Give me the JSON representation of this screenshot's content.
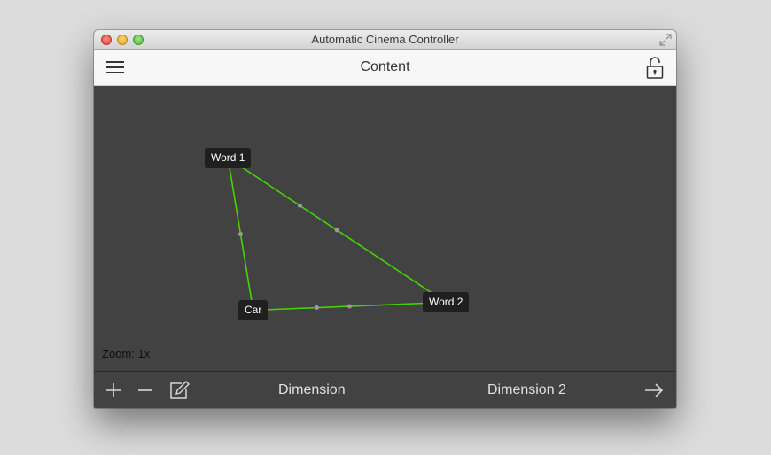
{
  "window": {
    "title": "Automatic Cinema Controller"
  },
  "toolbar": {
    "title": "Content",
    "menu_icon": "hamburger-menu-icon",
    "lock_icon": "unlocked-padlock-icon"
  },
  "graph": {
    "nodes": [
      {
        "id": "word1",
        "label": "Word 1"
      },
      {
        "id": "car",
        "label": "Car"
      },
      {
        "id": "word2",
        "label": "Word 2"
      }
    ],
    "edges": [
      {
        "from": "word1",
        "to": "word2"
      },
      {
        "from": "word1",
        "to": "car"
      },
      {
        "from": "car",
        "to": "word2"
      }
    ],
    "edge_color": "#46d400",
    "handle_color": "#9a9a9a"
  },
  "zoom": {
    "label": "Zoom: 1x"
  },
  "bottombar": {
    "add_icon": "plus-icon",
    "remove_icon": "minus-icon",
    "edit_icon": "edit-icon",
    "dimension_1": "Dimension",
    "dimension_2": "Dimension 2",
    "next_icon": "arrow-right-icon"
  },
  "colors": {
    "desktop": "#dcdcdc",
    "canvas": "#424242",
    "toolbar": "#f7f7f7",
    "node": "#1f1f1f"
  }
}
